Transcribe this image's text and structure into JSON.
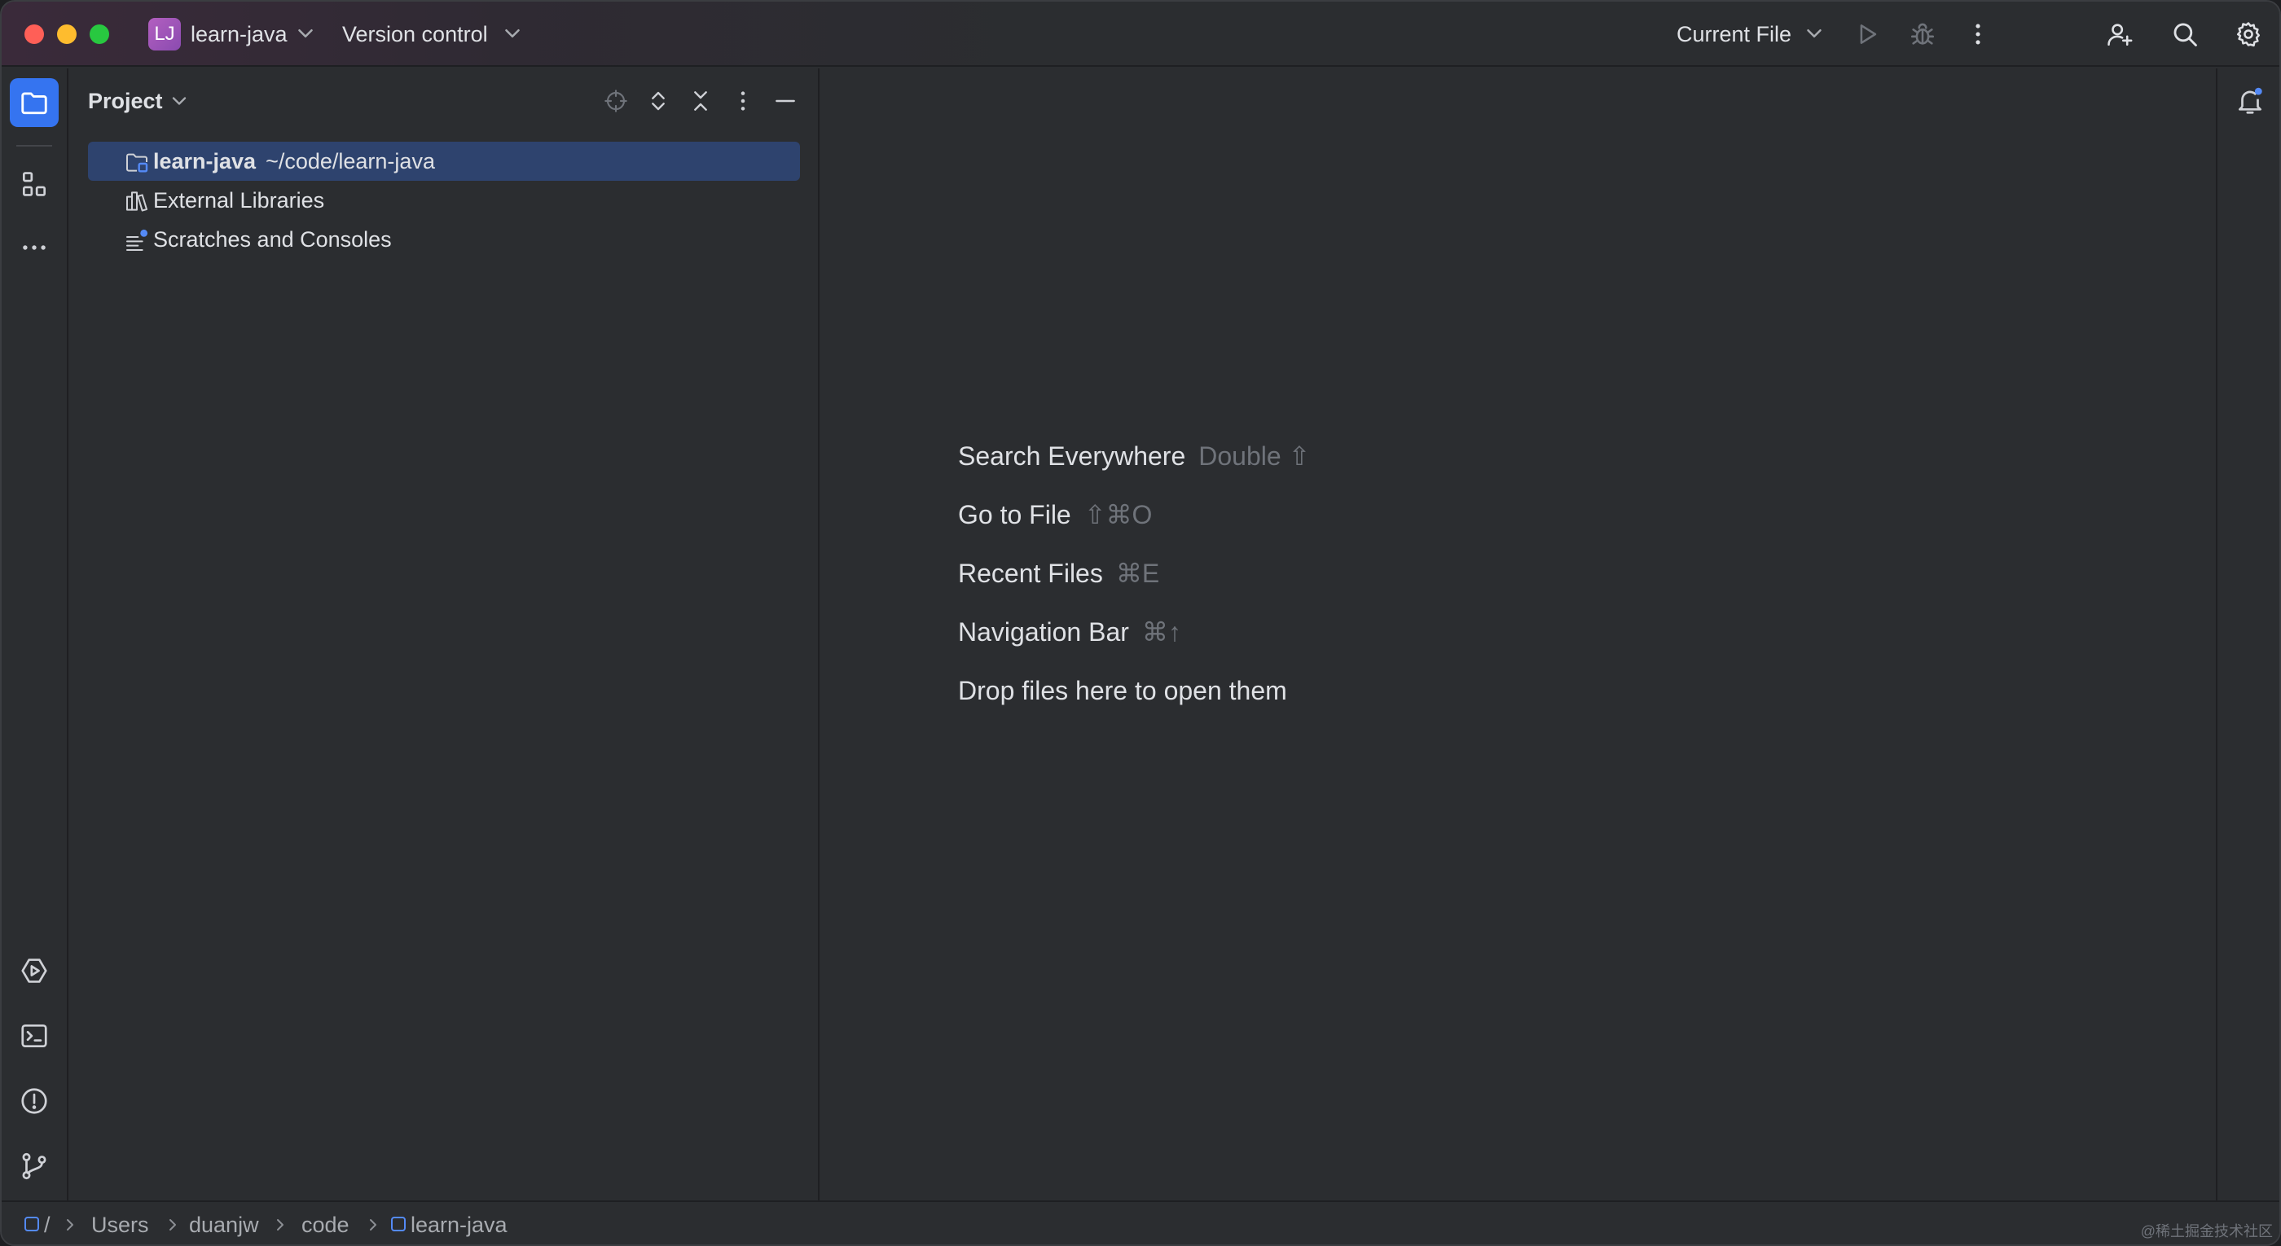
{
  "titlebar": {
    "project_badge": "LJ",
    "project_name": "learn-java",
    "vcs_label": "Version control",
    "run_config": "Current File",
    "icons": [
      "chevron-down-icon",
      "run-icon",
      "debug-icon",
      "more-vertical-icon",
      "add-user-icon",
      "search-icon",
      "settings-icon"
    ]
  },
  "left_toolbar": {
    "icons": [
      "folder-icon",
      "structure-icon",
      "more-horizontal-icon",
      "services-icon",
      "terminal-icon",
      "problems-icon",
      "git-branch-icon"
    ]
  },
  "right_toolbar": {
    "icons": [
      "notifications-icon"
    ]
  },
  "project_panel": {
    "title": "Project",
    "tools": [
      "locate-icon",
      "expand-all-icon",
      "collapse-all-icon",
      "options-icon",
      "hide-icon"
    ],
    "tree": [
      {
        "label": "learn-java",
        "path": "~/code/learn-java",
        "icon": "module-folder-icon",
        "selected": true
      },
      {
        "label": "External Libraries",
        "icon": "libraries-icon",
        "selected": false
      },
      {
        "label": "Scratches and Consoles",
        "icon": "scratches-icon",
        "selected": false
      }
    ]
  },
  "editor": {
    "hints": [
      {
        "label": "Search Everywhere",
        "shortcut": "Double ⇧"
      },
      {
        "label": "Go to File",
        "shortcut": "⇧⌘O"
      },
      {
        "label": "Recent Files",
        "shortcut": "⌘E"
      },
      {
        "label": "Navigation Bar",
        "shortcut": "⌘↑"
      },
      {
        "label": "Drop files here to open them",
        "shortcut": ""
      }
    ]
  },
  "statusbar": {
    "breadcrumbs": [
      "/",
      "Users",
      "duanjw",
      "code",
      "learn-java"
    ],
    "watermark": "@稀土掘金技术社区"
  },
  "colors": {
    "accent": "#3574f0",
    "selection": "#2e436e",
    "panel_bg": "#2b2d30",
    "text": "#dfe1e5",
    "muted": "#6f737a"
  }
}
